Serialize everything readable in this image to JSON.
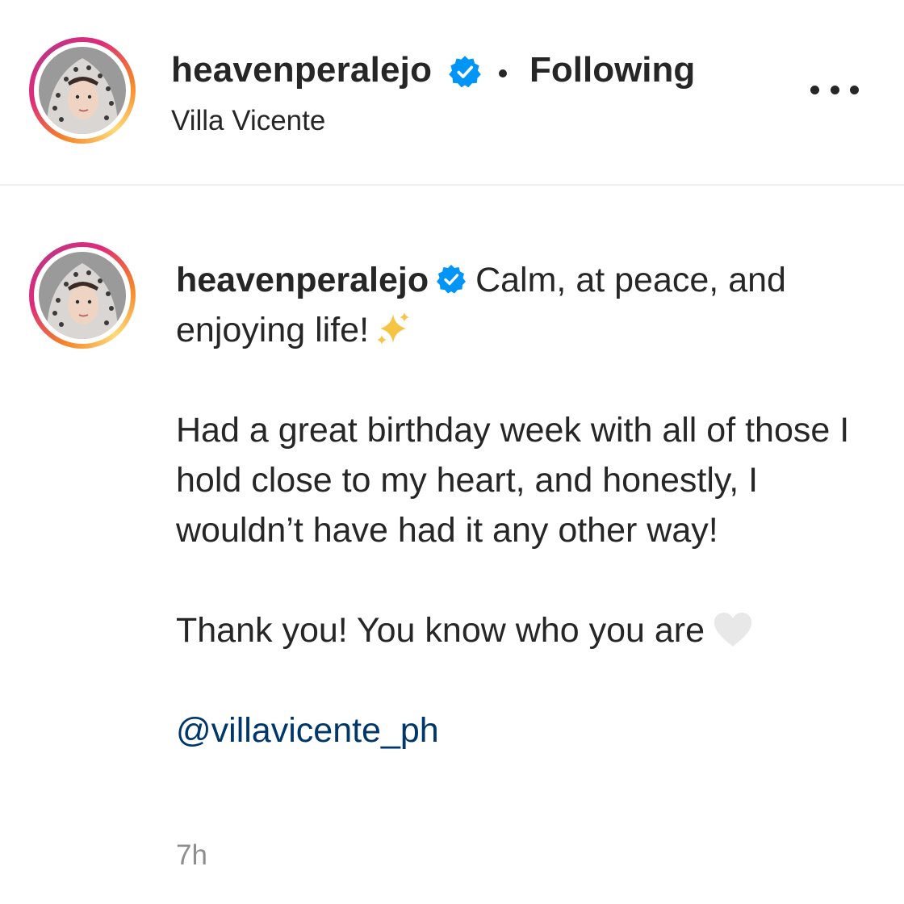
{
  "post_header": {
    "username": "heavenperalejo",
    "separator": "•",
    "follow_status": "Following",
    "location": "Villa Vicente",
    "more_label": "..."
  },
  "caption": {
    "username": "heavenperalejo",
    "line1_text": "Calm, at peace, and enjoying life!",
    "paragraph2": "Had a great birthday week with all of those I hold close to my heart, and honestly, I wouldn’t have had it any other way!",
    "paragraph3": "Thank you! You know who you are",
    "mention": "@villavicente_ph",
    "timestamp": "7h"
  },
  "icons": {
    "verified": "verified-badge-icon",
    "sparkles": "sparkles-emoji",
    "heart": "white-heart-emoji",
    "more": "more-options-icon"
  },
  "colors": {
    "text": "#262626",
    "verified_blue": "#0095f6",
    "link": "#00376b",
    "muted": "#8e8e8e",
    "sparkle": "#f6c445",
    "heart": "#e8e8e8"
  }
}
